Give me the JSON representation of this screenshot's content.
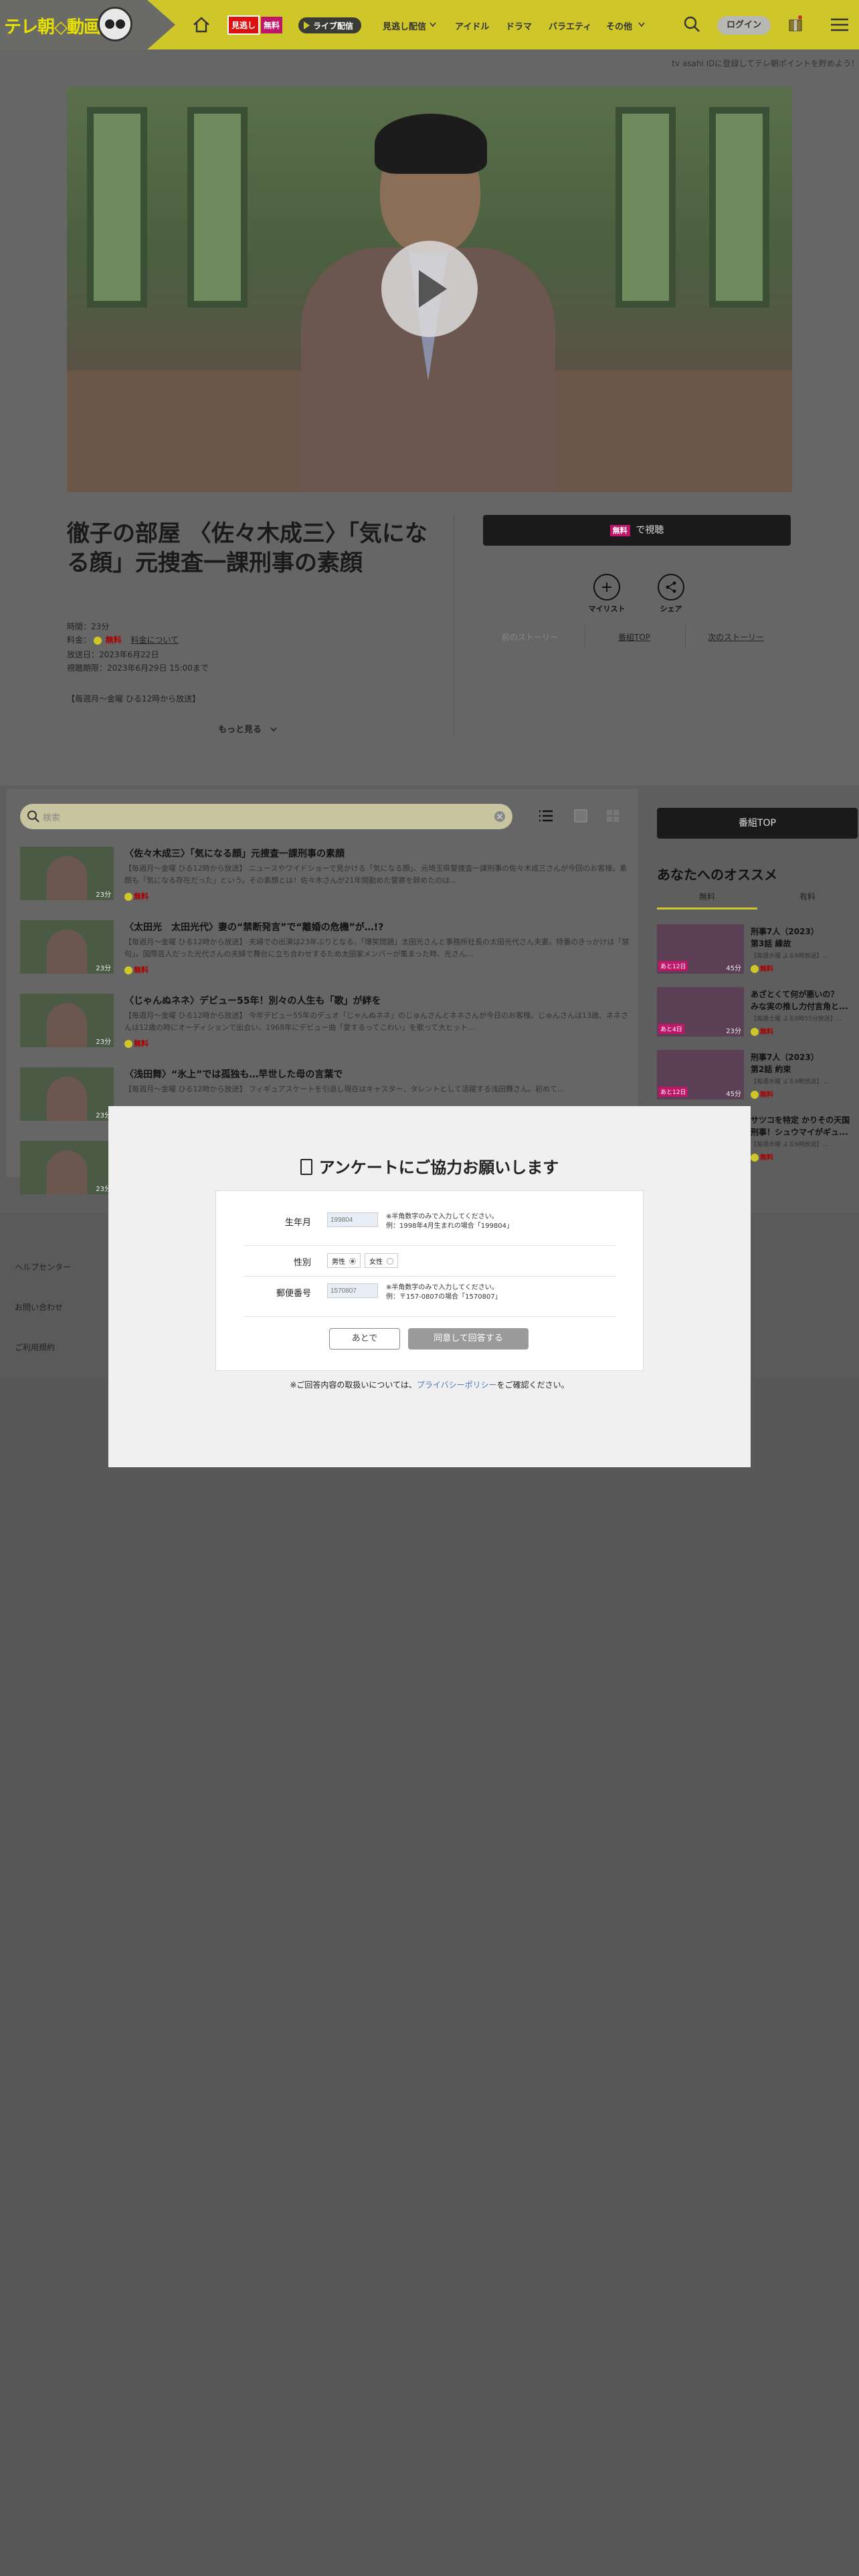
{
  "header": {
    "logo_text": "テレ朝◇動画",
    "badge_red": "見逃し",
    "badge_pink": "無料",
    "live_label": "ライブ配信",
    "nav": [
      "見逃し配信",
      "アイドル",
      "ドラマ",
      "バラエティ",
      "その他"
    ],
    "login": "ログイン",
    "notice": "tv asahi IDに登録してテレ朝ポイントを貯めよう！"
  },
  "program": {
    "title": "徹子の部屋 〈佐々木成三〉「気になる顔」元捜査一課刑事の素顔",
    "duration": "時間：23分",
    "price_label": "料金：",
    "price_value": "無料",
    "price_link": "料金について",
    "broadcast_date": "放送日：2023年6月22日",
    "available_until": "視聴期限：2023年6月29日 15:00まで",
    "schedule": "【毎週月～金曜 ひる12時から放送】",
    "more": "もっと見る",
    "watch_tag": "無料",
    "watch_label": "で視聴",
    "mylist": "マイリスト",
    "share": "シェア",
    "prev": "前のストーリー",
    "top": "番組TOP",
    "next": "次のストーリー"
  },
  "episodes": {
    "search_placeholder": "検索",
    "items": [
      {
        "title": "〈佐々木成三〉「気になる顔」元捜査一課刑事の素顔",
        "desc": "【毎週月～金曜 ひる12時から放送】 ニュースやワイドショーで見かける「気になる顔」、元埼玉県警捜査一課刑事の佐々木成三さんが今回のお客様。素顔も「気になる存在だった」という。その素顔とは！佐々木さんが21年間勤めた警察を辞めたのは…",
        "dur": "23分",
        "free": "無料"
      },
      {
        "title": "〈太田光　太田光代〉妻の“禁断発言”で“離婚の危機”が…!?",
        "desc": "【毎週月～金曜 ひる12時から放送】 夫婦での出演は23年ぶりとなる、「爆笑問題」太田光さんと事務所社長の太田光代さん夫妻。特番のきっかけは「禁句」。国際芸人だった光代さんの夫婦で舞台に立ち合わせするため太田家メンバーが集まった時、光さん…",
        "dur": "23分",
        "free": "無料"
      },
      {
        "title": "〈じゃんぬネネ〉デビュー55年！別々の人生も「歌」が絆を",
        "desc": "【毎週月～金曜 ひる12時から放送】 今年デビュー55年のデュオ「じゃんぬネネ」のじゅんさんとネネさんが今日のお客様。じゅんさんは13歳、ネネさんは12歳の時にオーディションで出会い、1968年にデビュー曲「愛するってこわい」を歌って大ヒット…",
        "dur": "23分",
        "free": "無料"
      },
      {
        "title": "〈浅田舞〉“氷上”では孤独も…早世した母の言葉で",
        "desc": "【毎週月～金曜 ひる12時から放送】 フィギュアスケートを引退し現在はキャスター、タレントとして活躍する浅田舞さん。初めて…",
        "dur": "23分",
        "free": "無料"
      },
      {
        "title": "",
        "desc": "",
        "dur": "23分",
        "free": ""
      }
    ]
  },
  "sidebar": {
    "top_button": "番組TOP",
    "heading": "あなたへのオススメ",
    "tab_free": "無料",
    "tab_paid": "有料",
    "recs": [
      {
        "t1": "刑事7人（2023）",
        "t2": "第3話 縁故",
        "t3": "【毎週水曜 よる9時放送】...",
        "badge": "あと12日",
        "dur": "45分",
        "free": "無料"
      },
      {
        "t1": "あざとくて何が悪いの？",
        "t2": "みな実の推し力付言角と...",
        "t3": "【毎週土曜 よる9時55分放送】...",
        "badge": "あと4日",
        "dur": "23分",
        "free": "無料"
      },
      {
        "t1": "刑事7人（2023）",
        "t2": "第2話 約束",
        "t3": "【毎週水曜 よる9時放送】 ...",
        "badge": "あと12日",
        "dur": "45分",
        "free": "無料"
      },
      {
        "t1": "サツコを特定 かりその天国",
        "t2": "刑事！シュウマイがギュ...",
        "t3": "【毎週水曜 よる9時放送】...",
        "badge": "",
        "dur": "",
        "free": "無料"
      }
    ]
  },
  "footer": {
    "help": "ヘルプセンター",
    "contact": "お問い合わせ",
    "terms": "ご利用規約"
  },
  "modal": {
    "title": "アンケートにご協力お願いします",
    "birth_label": "生年月",
    "birth_placeholder": "199804",
    "birth_note1": "※半角数字のみで入力してください。",
    "birth_note2": "例：1998年4月生まれの場合「199804」",
    "gender_label": "性別",
    "male": "男性",
    "female": "女性",
    "zip_label": "郵便番号",
    "zip_placeholder": "1570807",
    "zip_note1": "※半角数字のみで入力してください。",
    "zip_note2": "例：〒157-0807の場合「1570807」",
    "later": "あとで",
    "agree": "同意して回答する",
    "privacy_prefix": "※ご回答内容の取扱いについては、",
    "privacy_link": "プライバシーポリシー",
    "privacy_suffix": "をご確認ください。"
  }
}
